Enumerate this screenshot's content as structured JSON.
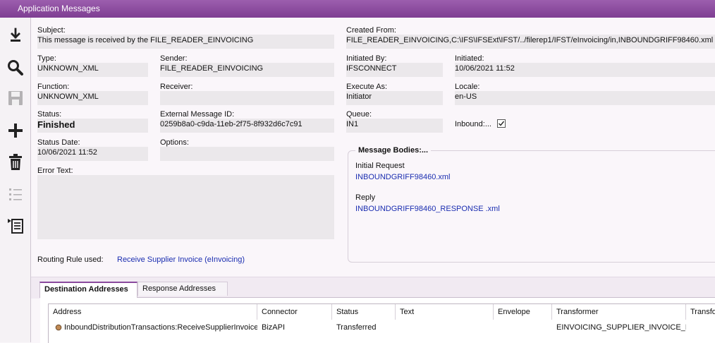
{
  "window": {
    "title": "Application Messages"
  },
  "toolbar": [
    {
      "name": "download-icon",
      "enabled": true
    },
    {
      "name": "search-icon",
      "enabled": true
    },
    {
      "name": "save-icon",
      "enabled": false
    },
    {
      "name": "add-icon",
      "enabled": true
    },
    {
      "name": "delete-icon",
      "enabled": true
    },
    {
      "name": "list-icon",
      "enabled": false
    },
    {
      "name": "details-icon",
      "enabled": true
    }
  ],
  "fields": {
    "subject": {
      "label": "Subject:",
      "value": "This message is received by the FILE_READER_EINVOICING"
    },
    "created_from": {
      "label": "Created From:",
      "value": "FILE_READER_EINVOICING,C:\\IFS\\IFSExt\\IFST/../filerep1/IFST/eInvoicing/in,INBOUNDGRIFF98460.xml"
    },
    "type": {
      "label": "Type:",
      "value": "UNKNOWN_XML"
    },
    "sender": {
      "label": "Sender:",
      "value": "FILE_READER_EINVOICING"
    },
    "initiated_by": {
      "label": "Initiated By:",
      "value": "IFSCONNECT"
    },
    "initiated": {
      "label": "Initiated:",
      "value": "10/06/2021 11:52"
    },
    "function": {
      "label": "Function:",
      "value": "UNKNOWN_XML"
    },
    "receiver": {
      "label": "Receiver:",
      "value": ""
    },
    "execute_as": {
      "label": "Execute As:",
      "value": "Initiator"
    },
    "locale": {
      "label": "Locale:",
      "value": "en-US"
    },
    "status": {
      "label": "Status:",
      "value": "Finished"
    },
    "external_id": {
      "label": "External Message ID:",
      "value": "0259b8a0-c9da-11eb-2f75-8f932d6c7c91"
    },
    "queue": {
      "label": "Queue:",
      "value": "IN1"
    },
    "inbound": {
      "label": "Inbound:...",
      "checked": true
    },
    "status_date": {
      "label": "Status Date:",
      "value": "10/06/2021 11:52"
    },
    "options": {
      "label": "Options:",
      "value": ""
    },
    "error_text": {
      "label": "Error Text:",
      "value": ""
    }
  },
  "message_bodies": {
    "title": "Message Bodies:...",
    "initial_label": "Initial Request",
    "initial_link": "INBOUNDGRIFF98460.xml",
    "reply_label": "Reply",
    "reply_link": "INBOUNDGRIFF98460_RESPONSE .xml"
  },
  "routing": {
    "label": "Routing Rule used:",
    "link": "Receive Supplier Invoice (eInvoicing)"
  },
  "tabs": [
    {
      "label": "Destination Addresses",
      "active": true
    },
    {
      "label": "Response Addresses",
      "active": false
    }
  ],
  "grid": {
    "columns": [
      "Address",
      "Connector",
      "Status",
      "Text",
      "Envelope",
      "Transformer",
      "Transfo"
    ],
    "rows": [
      [
        "InboundDistributionTransactions:ReceiveSupplierInvoice",
        "BizAPI",
        "Transferred",
        "",
        "",
        "EINVOICING_SUPPLIER_INVOICE_IN",
        ""
      ]
    ]
  }
}
